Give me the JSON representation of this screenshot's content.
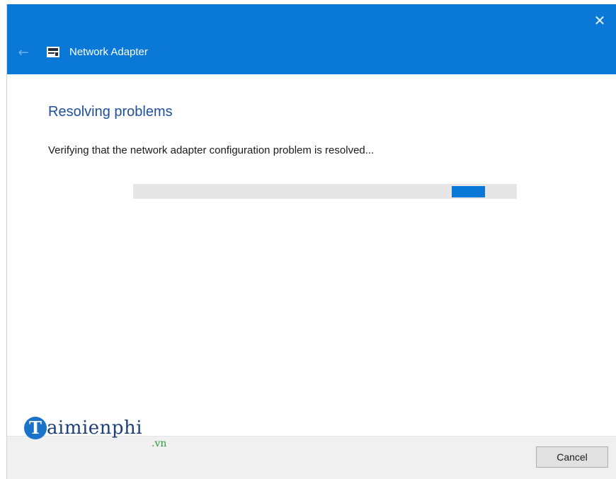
{
  "window": {
    "title": "Network Adapter",
    "close_glyph": "✕",
    "back_glyph": "←",
    "accent_color": "#0a78d6",
    "icon": "network-adapter-icon"
  },
  "content": {
    "heading": "Resolving problems",
    "status": "Verifying that the network adapter configuration problem is resolved...",
    "progress": {
      "mode": "indeterminate",
      "chunk_position_fraction": 0.83,
      "chunk_width_fraction": 0.087
    }
  },
  "footer": {
    "cancel_label": "Cancel"
  },
  "watermark": {
    "initial": "T",
    "name": "aimienphi",
    "tld": ".vn"
  }
}
